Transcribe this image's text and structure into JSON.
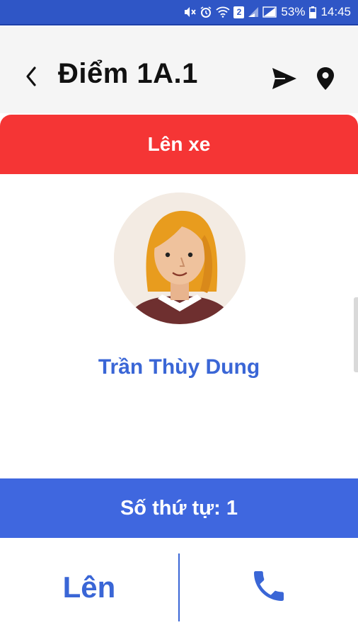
{
  "status_bar": {
    "battery": "53%",
    "time": "14:45",
    "icons": [
      "mute-icon",
      "alarm-icon",
      "wifi-icon",
      "sim2-icon",
      "signal-icon",
      "signal-icon-2",
      "battery-icon"
    ],
    "sim_label": "2"
  },
  "header": {
    "title": "Điểm 1A.1",
    "back_icon": "chevron-left-icon",
    "send_icon": "send-icon",
    "location_icon": "location-pin-icon"
  },
  "card": {
    "banner_label": "Lên xe",
    "passenger_name": "Trần Thùy Dung",
    "avatar_icon": "female-avatar-icon"
  },
  "order": {
    "label": "Số thứ tự: 1"
  },
  "actions": {
    "board_label": "Lên",
    "call_icon": "phone-icon"
  },
  "colors": {
    "status_bar": "#2f56c6",
    "banner_red": "#f53535",
    "accent_blue": "#3a66d6",
    "order_bar_blue": "#3f67df"
  }
}
